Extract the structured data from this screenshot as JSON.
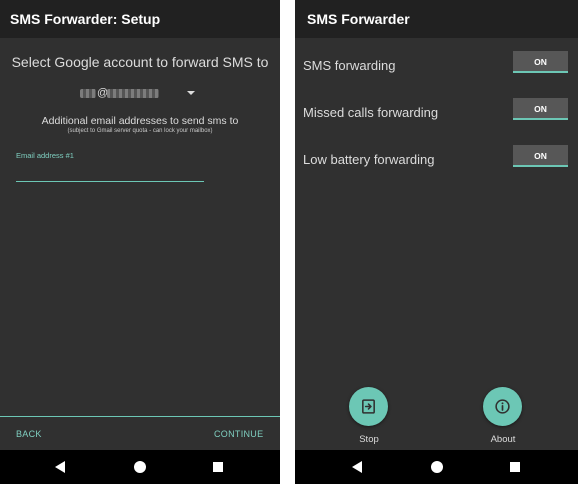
{
  "setup_screen": {
    "title": "SMS Forwarder: Setup",
    "heading": "Select Google account to forward SMS to",
    "account_at": "@",
    "extra_heading": "Additional email addresses to send sms to",
    "extra_note": "(subject to Gmail server quota - can lock your mailbox)",
    "email_label": "Email address #1",
    "email_value": "",
    "back_label": "BACK",
    "continue_label": "CONTINUE"
  },
  "main_screen": {
    "title": "SMS Forwarder",
    "settings": [
      {
        "label": "SMS forwarding",
        "state": "ON"
      },
      {
        "label": "Missed calls forwarding",
        "state": "ON"
      },
      {
        "label": "Low battery forwarding",
        "state": "ON"
      }
    ],
    "stop_label": "Stop",
    "about_label": "About",
    "stop_icon": "exit-icon",
    "about_icon": "info-icon"
  },
  "colors": {
    "accent": "#6cc7b5",
    "background": "#303030",
    "appbar": "#212121",
    "toggle": "#575757"
  }
}
